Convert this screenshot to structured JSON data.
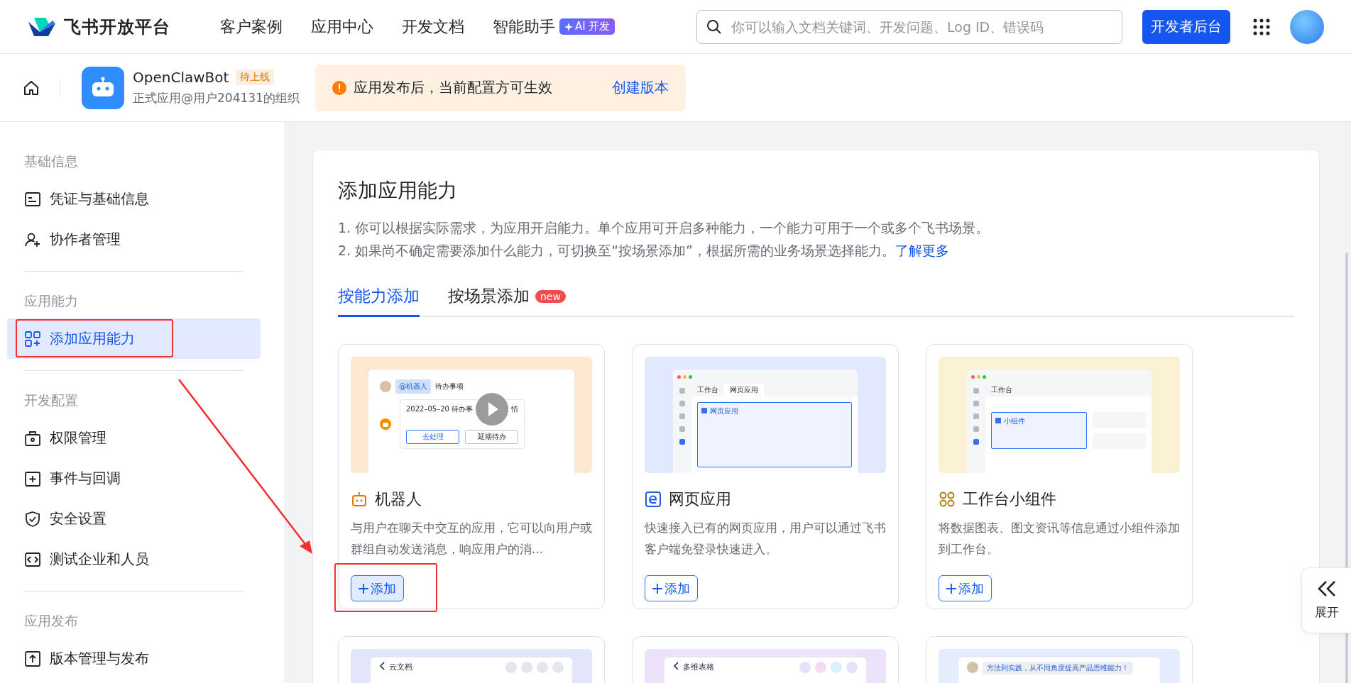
{
  "brand": {
    "name": "飞书开放平台"
  },
  "nav": [
    {
      "label": "客户案例"
    },
    {
      "label": "应用中心"
    },
    {
      "label": "开发文档"
    },
    {
      "label": "智能助手",
      "badge": "AI 开发"
    }
  ],
  "search": {
    "placeholder": "你可以输入文档关键词、开发问题、Log ID、错误码"
  },
  "console_button": "开发者后台",
  "app": {
    "name": "OpenClawBot",
    "status": "待上线",
    "org": "正式应用@用户204131的组织"
  },
  "notice": {
    "text": "应用发布后，当前配置方可生效",
    "action": "创建版本"
  },
  "sidebar": {
    "sections": [
      {
        "title": "基础信息",
        "items": [
          {
            "kind": "credential",
            "label": "凭证与基础信息",
            "selected": false,
            "annotated": false
          },
          {
            "kind": "people",
            "label": "协作者管理",
            "selected": false,
            "annotated": false
          }
        ]
      },
      {
        "title": "应用能力",
        "items": [
          {
            "kind": "grid",
            "label": "添加应用能力",
            "selected": true,
            "annotated": true
          }
        ]
      },
      {
        "title": "开发配置",
        "items": [
          {
            "kind": "lock",
            "label": "权限管理",
            "selected": false,
            "annotated": false
          },
          {
            "kind": "event",
            "label": "事件与回调",
            "selected": false,
            "annotated": false
          },
          {
            "kind": "shield",
            "label": "安全设置",
            "selected": false,
            "annotated": false
          },
          {
            "kind": "code",
            "label": "测试企业和人员",
            "selected": false,
            "annotated": false
          }
        ]
      },
      {
        "title": "应用发布",
        "items": [
          {
            "kind": "upload",
            "label": "版本管理与发布",
            "selected": false,
            "annotated": false
          }
        ]
      }
    ]
  },
  "panel": {
    "title": "添加应用能力",
    "notes": [
      "1. 你可以根据实际需求，为应用开启能力。单个应用可开启多种能力，一个能力可用于一个或多个飞书场景。",
      "2. 如果尚不确定需要添加什么能力，可切换至“按场景添加”，根据所需的业务场景选择能力。"
    ],
    "notes_link": "了解更多",
    "tabs": [
      {
        "label": "按能力添加",
        "selected": true
      },
      {
        "label": "按场景添加",
        "selected": false,
        "badge": "new"
      }
    ],
    "cards": [
      {
        "kind": "bot",
        "title": "机器人",
        "description": "与用户在聊天中交互的应用，它可以向用户或群组自动发送消息，响应用户的消...",
        "button": "添加",
        "annotated": true,
        "preview": {
          "mention": "@机器人",
          "subject": "待办事项",
          "line_start": "2022–05–20 待办事",
          "line_end": "情",
          "actions": [
            "去处理",
            "延期待办"
          ]
        }
      },
      {
        "kind": "web",
        "title": "网页应用",
        "description": "快速接入已有的网页应用，用户可以通过飞书客户端免登录快速进入。",
        "button": "添加",
        "annotated": false,
        "preview": {
          "tabs": [
            "工作台",
            "网页应用"
          ],
          "block": "网页应用"
        }
      },
      {
        "kind": "widget",
        "title": "工作台小组件",
        "description": "将数据图表、图文资讯等信息通过小组件添加到工作台。",
        "button": "添加",
        "annotated": false,
        "preview": {
          "tabs": [
            "工作台"
          ],
          "block": "小组件"
        }
      }
    ],
    "more_cards": [
      {
        "kind": "doc",
        "title": "云文档"
      },
      {
        "kind": "base",
        "title": "多维表格"
      },
      {
        "kind": "chat",
        "message": "方法到实践，从不同角度提高产品思维能力！"
      }
    ]
  },
  "expand_button": "展开"
}
